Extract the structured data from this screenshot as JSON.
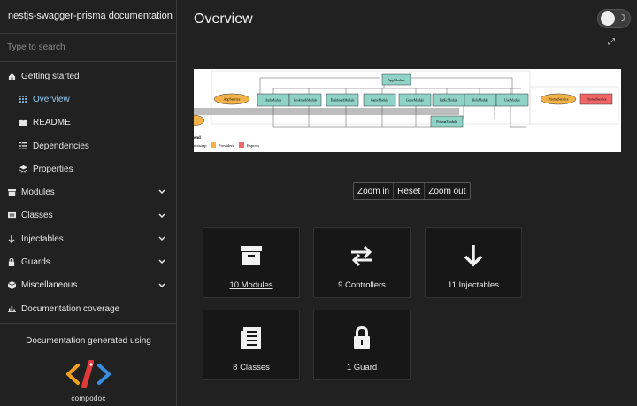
{
  "sidebar": {
    "title": "nestjs-swagger-prisma documentation",
    "search_placeholder": "Type to search",
    "items": [
      {
        "label": "Getting started",
        "icon": "home-icon"
      },
      {
        "label": "Overview",
        "icon": "grid-icon"
      },
      {
        "label": "README",
        "icon": "book-icon"
      },
      {
        "label": "Dependencies",
        "icon": "list-icon"
      },
      {
        "label": "Properties",
        "icon": "stack-icon"
      },
      {
        "label": "Modules",
        "icon": "archive-icon"
      },
      {
        "label": "Classes",
        "icon": "file-icon"
      },
      {
        "label": "Injectables",
        "icon": "arrow-down-icon"
      },
      {
        "label": "Guards",
        "icon": "lock-icon"
      },
      {
        "label": "Miscellaneous",
        "icon": "cube-icon"
      },
      {
        "label": "Documentation coverage",
        "icon": "bar-chart-icon"
      }
    ],
    "footer_text": "Documentation generated using",
    "logo_text": "compodoc"
  },
  "main": {
    "title": "Overview",
    "zoom": {
      "in": "Zoom in",
      "reset": "Reset",
      "out": "Zoom out"
    },
    "graph": {
      "root": "AppModule",
      "modules": [
        "AuthModule",
        "BookmarkModule",
        "DashboardModule",
        "GameModule",
        "GenreModule",
        "PrismaModule",
        "PublicModule",
        "RoleModule",
        "UserModule"
      ],
      "left_service": "AppService",
      "right_service": "PrismaService",
      "export_service": "PrismaService",
      "legend_title": "end",
      "legend_bootstrap": "ootstrap",
      "legend_providers": "Providers",
      "legend_exports": "Exports"
    },
    "cards": [
      {
        "label": "10 Modules",
        "icon": "archive-icon"
      },
      {
        "label": "9 Controllers",
        "icon": "exchange-icon"
      },
      {
        "label": "11 Injectables",
        "icon": "arrow-down-icon"
      },
      {
        "label": "8 Classes",
        "icon": "file-text-icon"
      },
      {
        "label": "1 Guard",
        "icon": "lock-icon"
      }
    ]
  }
}
